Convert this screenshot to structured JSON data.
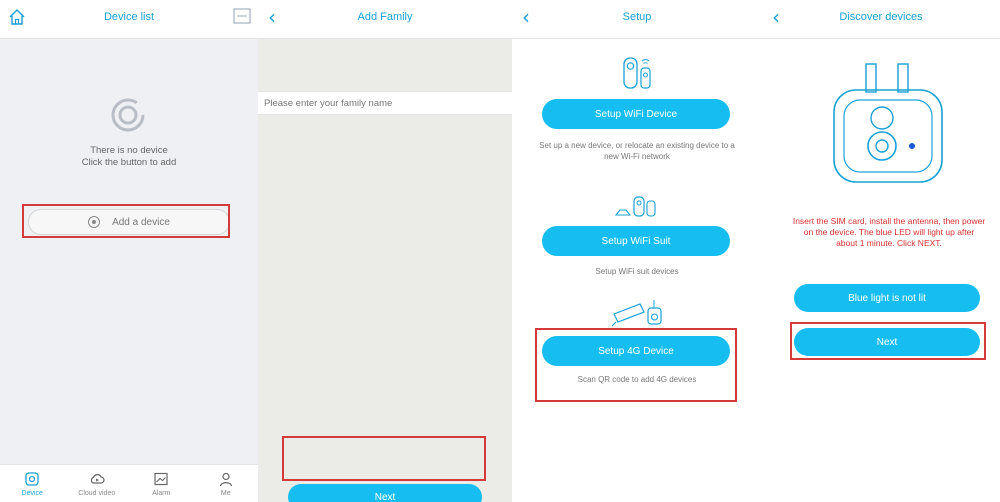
{
  "panels": {
    "device_list": {
      "title": "Device list",
      "empty_line1": "There is no device",
      "empty_line2": "Click the button to add",
      "add_button": "Add a device",
      "tabs": [
        {
          "label": "Device",
          "icon": "device-icon",
          "active": true
        },
        {
          "label": "Cloud video",
          "icon": "cloud-video-icon",
          "active": false
        },
        {
          "label": "Alarm",
          "icon": "alarm-icon",
          "active": false
        },
        {
          "label": "Me",
          "icon": "me-icon",
          "active": false
        }
      ]
    },
    "add_family": {
      "title": "Add Family",
      "input_placeholder": "Please enter your family name",
      "input_value": "",
      "next_button": "Next"
    },
    "setup": {
      "title": "Setup",
      "wifi_device_button": "Setup WiFi Device",
      "wifi_device_desc": "Set up a new device, or relocate an existing device to a new Wi-Fi network",
      "wifi_suit_button": "Setup WiFi Suit",
      "wifi_suit_desc": "Setup WiFi suit devices",
      "four_g_button": "Setup 4G Device",
      "four_g_desc": "Scan QR code to add 4G devices"
    },
    "discover": {
      "title": "Discover devices",
      "instruction": "Insert the SIM card, install the antenna, then power on the device. The blue LED will light up after about 1 minute. Click NEXT.",
      "not_lit_button": "Blue light is not lit",
      "next_button": "Next"
    }
  },
  "colors": {
    "accent": "#1aa0d6",
    "button": "#16bdf0",
    "highlight": "#d43a3a",
    "warning": "#d63030"
  },
  "back_glyph": "‹"
}
